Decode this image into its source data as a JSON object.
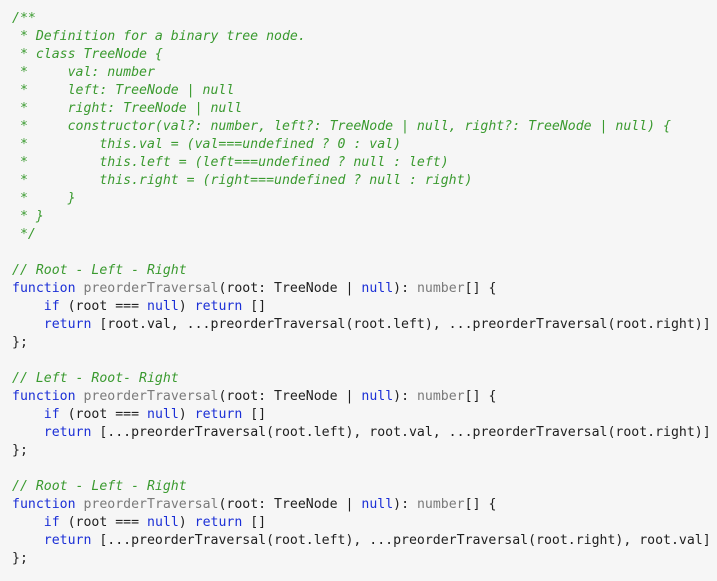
{
  "colors": {
    "background": "#f6f6f6",
    "comment": "#3a9a2f",
    "keyword": "#1b2fd6",
    "function_name": "#7a7a7a",
    "plain": "#202020"
  },
  "code": {
    "lines": [
      [
        {
          "t": "comment",
          "v": "/**"
        }
      ],
      [
        {
          "t": "comment",
          "v": " * Definition for a binary tree node."
        }
      ],
      [
        {
          "t": "comment",
          "v": " * class TreeNode {"
        }
      ],
      [
        {
          "t": "comment",
          "v": " *     val: number"
        }
      ],
      [
        {
          "t": "comment",
          "v": " *     left: TreeNode | null"
        }
      ],
      [
        {
          "t": "comment",
          "v": " *     right: TreeNode | null"
        }
      ],
      [
        {
          "t": "comment",
          "v": " *     constructor(val?: number, left?: TreeNode | null, right?: TreeNode | null) {"
        }
      ],
      [
        {
          "t": "comment",
          "v": " *         this.val = (val===undefined ? 0 : val)"
        }
      ],
      [
        {
          "t": "comment",
          "v": " *         this.left = (left===undefined ? null : left)"
        }
      ],
      [
        {
          "t": "comment",
          "v": " *         this.right = (right===undefined ? null : right)"
        }
      ],
      [
        {
          "t": "comment",
          "v": " *     }"
        }
      ],
      [
        {
          "t": "comment",
          "v": " * }"
        }
      ],
      [
        {
          "t": "comment",
          "v": " */"
        }
      ],
      [],
      [
        {
          "t": "comment",
          "v": "// Root - Left - Right"
        }
      ],
      [
        {
          "t": "keyword",
          "v": "function"
        },
        {
          "t": "plain",
          "v": " "
        },
        {
          "t": "func",
          "v": "preorderTraversal"
        },
        {
          "t": "plain",
          "v": "(root: TreeNode | "
        },
        {
          "t": "keyword",
          "v": "null"
        },
        {
          "t": "plain",
          "v": "): "
        },
        {
          "t": "func",
          "v": "number"
        },
        {
          "t": "plain",
          "v": "[] {"
        }
      ],
      [
        {
          "t": "plain",
          "v": "    "
        },
        {
          "t": "keyword",
          "v": "if"
        },
        {
          "t": "plain",
          "v": " (root === "
        },
        {
          "t": "keyword",
          "v": "null"
        },
        {
          "t": "plain",
          "v": ") "
        },
        {
          "t": "keyword",
          "v": "return"
        },
        {
          "t": "plain",
          "v": " []"
        }
      ],
      [
        {
          "t": "plain",
          "v": "    "
        },
        {
          "t": "keyword",
          "v": "return"
        },
        {
          "t": "plain",
          "v": " [root.val, ...preorderTraversal(root.left), ...preorderTraversal(root.right)]"
        }
      ],
      [
        {
          "t": "plain",
          "v": "};"
        }
      ],
      [],
      [
        {
          "t": "comment",
          "v": "// Left - Root- Right"
        }
      ],
      [
        {
          "t": "keyword",
          "v": "function"
        },
        {
          "t": "plain",
          "v": " "
        },
        {
          "t": "func",
          "v": "preorderTraversal"
        },
        {
          "t": "plain",
          "v": "(root: TreeNode | "
        },
        {
          "t": "keyword",
          "v": "null"
        },
        {
          "t": "plain",
          "v": "): "
        },
        {
          "t": "func",
          "v": "number"
        },
        {
          "t": "plain",
          "v": "[] {"
        }
      ],
      [
        {
          "t": "plain",
          "v": "    "
        },
        {
          "t": "keyword",
          "v": "if"
        },
        {
          "t": "plain",
          "v": " (root === "
        },
        {
          "t": "keyword",
          "v": "null"
        },
        {
          "t": "plain",
          "v": ") "
        },
        {
          "t": "keyword",
          "v": "return"
        },
        {
          "t": "plain",
          "v": " []"
        }
      ],
      [
        {
          "t": "plain",
          "v": "    "
        },
        {
          "t": "keyword",
          "v": "return"
        },
        {
          "t": "plain",
          "v": " [...preorderTraversal(root.left), root.val, ...preorderTraversal(root.right)]"
        }
      ],
      [
        {
          "t": "plain",
          "v": "};"
        }
      ],
      [],
      [
        {
          "t": "comment",
          "v": "// Root - Left - Right"
        }
      ],
      [
        {
          "t": "keyword",
          "v": "function"
        },
        {
          "t": "plain",
          "v": " "
        },
        {
          "t": "func",
          "v": "preorderTraversal"
        },
        {
          "t": "plain",
          "v": "(root: TreeNode | "
        },
        {
          "t": "keyword",
          "v": "null"
        },
        {
          "t": "plain",
          "v": "): "
        },
        {
          "t": "func",
          "v": "number"
        },
        {
          "t": "plain",
          "v": "[] {"
        }
      ],
      [
        {
          "t": "plain",
          "v": "    "
        },
        {
          "t": "keyword",
          "v": "if"
        },
        {
          "t": "plain",
          "v": " (root === "
        },
        {
          "t": "keyword",
          "v": "null"
        },
        {
          "t": "plain",
          "v": ") "
        },
        {
          "t": "keyword",
          "v": "return"
        },
        {
          "t": "plain",
          "v": " []"
        }
      ],
      [
        {
          "t": "plain",
          "v": "    "
        },
        {
          "t": "keyword",
          "v": "return"
        },
        {
          "t": "plain",
          "v": " [...preorderTraversal(root.left), ...preorderTraversal(root.right), root.val]"
        }
      ],
      [
        {
          "t": "plain",
          "v": "};"
        }
      ]
    ]
  }
}
